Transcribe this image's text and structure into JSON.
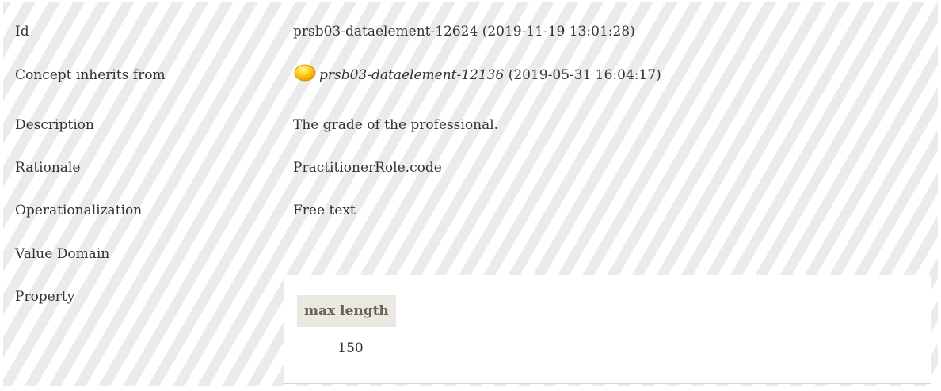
{
  "details": {
    "id": {
      "label": "Id",
      "value": "prsb03-dataelement-12624 (2019-11-19 13:01:28)"
    },
    "concept_inherits_from": {
      "label": "Concept inherits from",
      "icon": "concept-circle-icon",
      "icon_color": "#f5b800",
      "ref": "prsb03-dataelement-12136",
      "date": " (2019-05-31 16:04:17)"
    },
    "description": {
      "label": "Description",
      "value": "The grade of the professional."
    },
    "rationale": {
      "label": "Rationale",
      "value": "PractitionerRole.code"
    },
    "operationalization": {
      "label": "Operationalization",
      "value": "Free text"
    },
    "value_domain": {
      "label": "Value Domain",
      "value": ""
    },
    "property": {
      "label": "Property",
      "header": "max length",
      "value": "150"
    }
  }
}
